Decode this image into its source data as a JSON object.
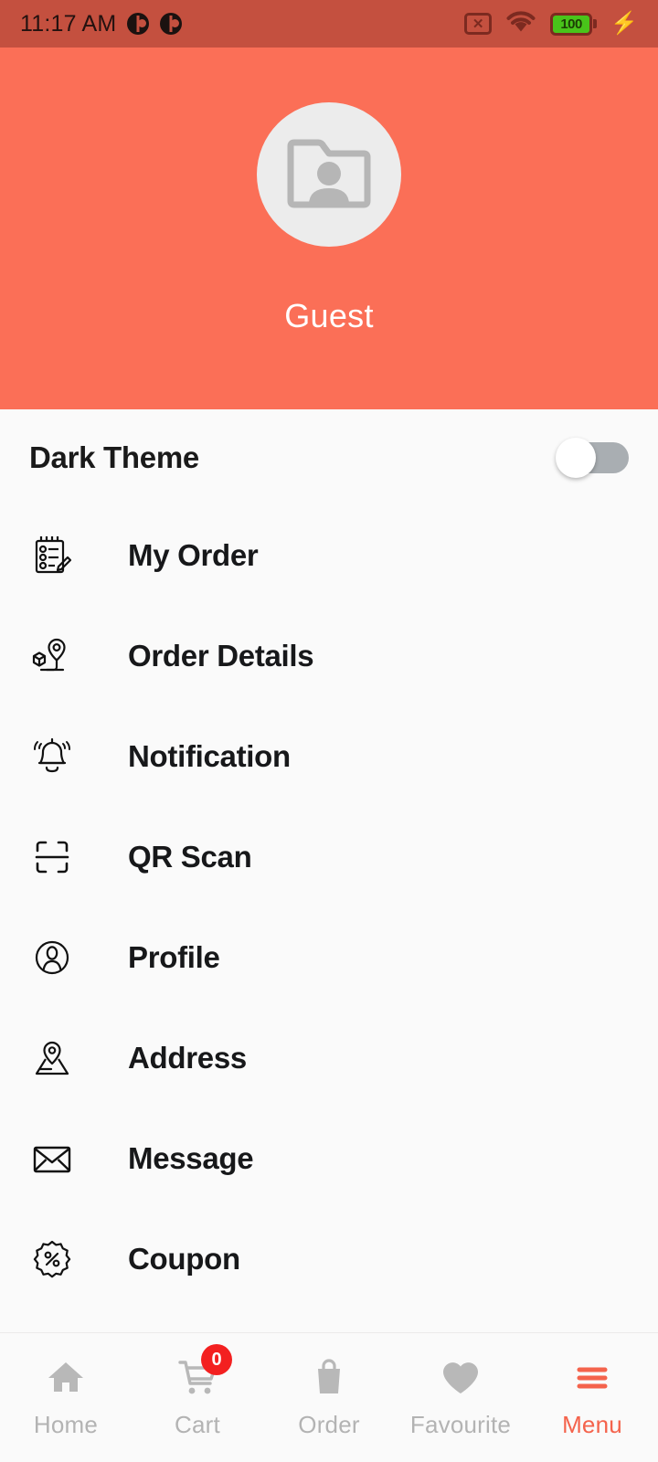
{
  "status_bar": {
    "time": "11:17 AM",
    "app_icons": [
      "app-notification-icon",
      "app-notification-icon"
    ],
    "sim_icon": "sim-card-error-icon",
    "sim_glyph": "✕",
    "wifi_icon": "wifi-icon",
    "battery_level": "100",
    "battery_icon": "battery-icon",
    "charging_icon": "charging-bolt-icon",
    "bolt_glyph": "⚡",
    "background_color": "#c4503f"
  },
  "header": {
    "avatar_icon": "avatar-placeholder-icon",
    "user_name": "Guest",
    "background_color": "#fb6f57",
    "avatar_background_color": "#ececec"
  },
  "settings": {
    "dark_theme_label": "Dark Theme",
    "dark_theme_enabled": false
  },
  "menu": {
    "items": [
      {
        "label": "My Order",
        "icon": "notepad-checklist-icon"
      },
      {
        "label": "Order Details",
        "icon": "package-location-pin-icon"
      },
      {
        "label": "Notification",
        "icon": "bell-ringing-icon"
      },
      {
        "label": "QR Scan",
        "icon": "qr-scan-frame-icon"
      },
      {
        "label": "Profile",
        "icon": "person-circle-icon"
      },
      {
        "label": "Address",
        "icon": "map-pin-icon"
      },
      {
        "label": "Message",
        "icon": "envelope-icon"
      },
      {
        "label": "Coupon",
        "icon": "percent-badge-icon"
      }
    ]
  },
  "bottom_nav": {
    "active_index": 4,
    "active_color": "#f4634c",
    "inactive_color": "#b3b3b3",
    "items": [
      {
        "label": "Home",
        "icon": "home-icon",
        "badge": null
      },
      {
        "label": "Cart",
        "icon": "cart-icon",
        "badge": "0"
      },
      {
        "label": "Order",
        "icon": "bag-icon",
        "badge": null
      },
      {
        "label": "Favourite",
        "icon": "heart-icon",
        "badge": null
      },
      {
        "label": "Menu",
        "icon": "hamburger-icon",
        "badge": null
      }
    ]
  }
}
